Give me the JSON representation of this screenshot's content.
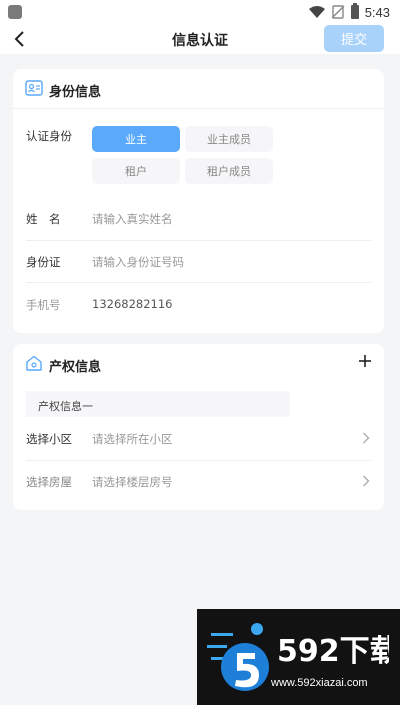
{
  "status_bar": {
    "time": "5:43"
  },
  "nav": {
    "title": "信息认证",
    "submit_label": "提交"
  },
  "identity": {
    "title": "身份信息",
    "role_label": "认证身份",
    "roles": [
      {
        "label": "业主",
        "selected": true
      },
      {
        "label": "业主成员",
        "selected": false
      },
      {
        "label": "租户",
        "selected": false
      },
      {
        "label": "租户成员",
        "selected": false
      }
    ],
    "fields": [
      {
        "label": "姓　名",
        "placeholder": "请输入真实姓名",
        "value": ""
      },
      {
        "label": "身份证",
        "placeholder": "请输入身份证号码",
        "value": ""
      },
      {
        "label": "手机号",
        "placeholder": "",
        "value": "13268282116"
      }
    ]
  },
  "property": {
    "title": "产权信息",
    "group_title": "产权信息一",
    "fields": [
      {
        "label": "选择小区",
        "placeholder": "请选择所在小区"
      },
      {
        "label": "选择房屋",
        "placeholder": "请选择楼层房号"
      }
    ]
  },
  "watermark": {
    "url": "www.592xiazai.com"
  },
  "colors": {
    "primary": "#5aa9fa",
    "submit_disabled": "#a9d2fb",
    "background": "#f4f5f7"
  }
}
